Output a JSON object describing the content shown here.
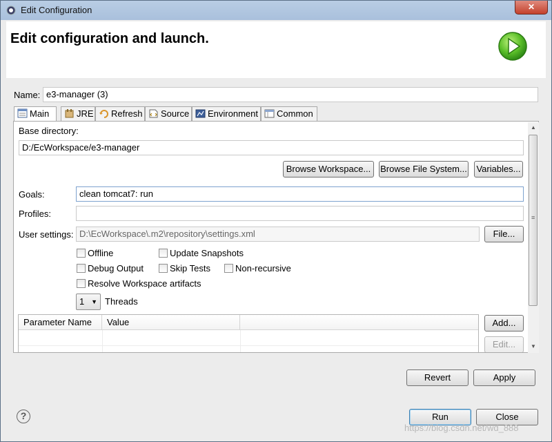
{
  "window": {
    "title": "Edit Configuration",
    "close_glyph": "✕"
  },
  "header": {
    "title": "Edit configuration and launch.",
    "icon": "run-icon"
  },
  "name": {
    "label": "Name:",
    "value": "e3-manager (3)"
  },
  "tabs": [
    {
      "label": "Main",
      "icon": "main-tab-icon",
      "active": true
    },
    {
      "label": "JRE",
      "icon": "jre-icon"
    },
    {
      "label": "Refresh",
      "icon": "refresh-icon"
    },
    {
      "label": "Source",
      "icon": "source-icon"
    },
    {
      "label": "Environment",
      "icon": "environment-icon"
    },
    {
      "label": "Common",
      "icon": "common-icon"
    }
  ],
  "main": {
    "base_dir_label": "Base directory:",
    "base_dir_value": "D:/EcWorkspace/e3-manager",
    "browse_workspace": "Browse Workspace...",
    "browse_fs": "Browse File System...",
    "variables": "Variables...",
    "goals_label": "Goals:",
    "goals_value": "clean tomcat7: run",
    "profiles_label": "Profiles:",
    "profiles_value": "",
    "user_settings_label": "User settings:",
    "user_settings_value": "D:\\EcWorkspace\\.m2\\repository\\settings.xml",
    "file_button": "File...",
    "checkboxes": {
      "offline": "Offline",
      "update_snapshots": "Update Snapshots",
      "debug_output": "Debug Output",
      "skip_tests": "Skip Tests",
      "non_recursive": "Non-recursive",
      "resolve_workspace": "Resolve Workspace artifacts"
    },
    "threads_value": "1",
    "threads_label": "Threads",
    "table": {
      "col1": "Parameter Name",
      "col2": "Value"
    },
    "add_button": "Add...",
    "edit_button": "Edit..."
  },
  "buttons": {
    "revert": "Revert",
    "apply": "Apply",
    "run": "Run",
    "close": "Close"
  },
  "help_glyph": "?",
  "watermark": "https://blog.csdn.net/wd_888"
}
